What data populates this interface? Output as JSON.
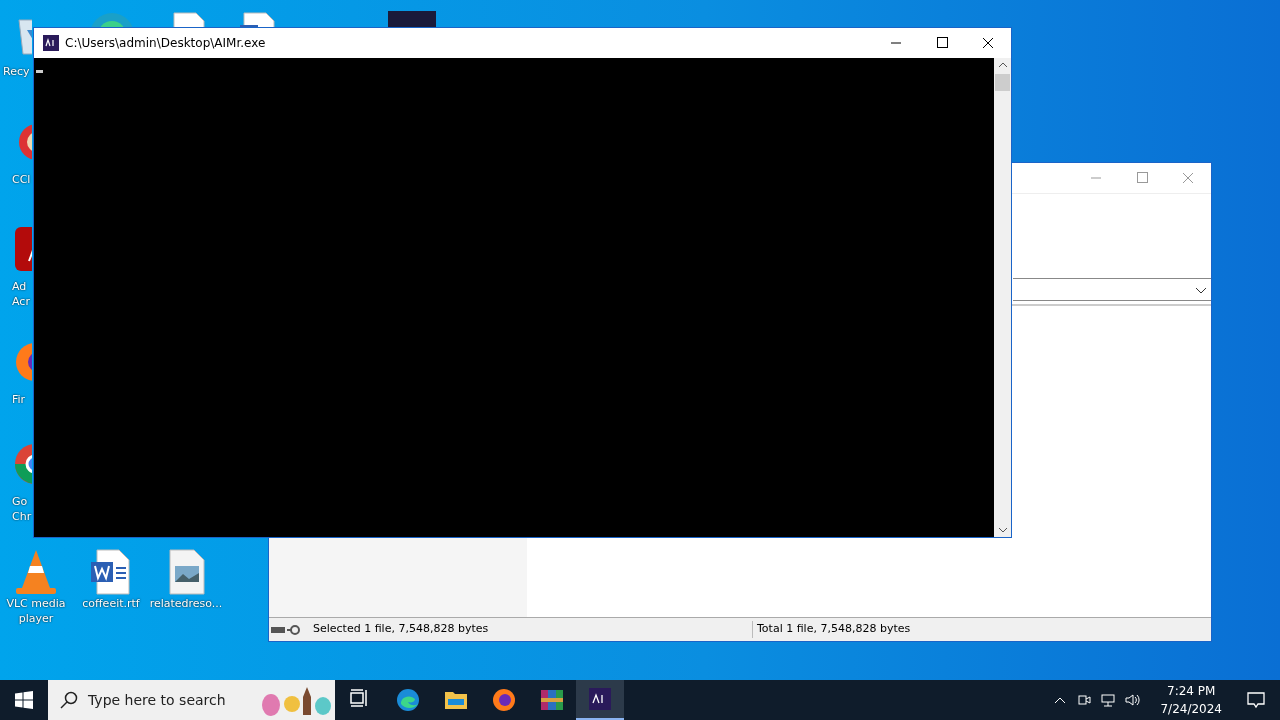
{
  "desktop_icons": [
    {
      "kind": "recycle",
      "lines": [
        "Recy"
      ]
    },
    {
      "kind": "ccleaner",
      "lines": [
        "CCl"
      ]
    },
    {
      "kind": "acrobat",
      "lines": [
        "Ad",
        "Acr"
      ]
    },
    {
      "kind": "firefox",
      "lines": [
        "Fir"
      ]
    },
    {
      "kind": "chrome",
      "lines": [
        "Go",
        "Chr"
      ]
    },
    {
      "kind": "vlc",
      "lines": [
        "VLC media",
        "player"
      ]
    },
    {
      "kind": "word",
      "lines": [
        "coffeeit.rtf"
      ]
    },
    {
      "kind": "image",
      "lines": [
        "relatedreso..."
      ]
    }
  ],
  "console": {
    "title": "C:\\Users\\admin\\Desktop\\AIMr.exe"
  },
  "back_window": {
    "status_left": "Selected 1 file, 7,548,828 bytes",
    "status_right": "Total 1 file, 7,548,828 bytes"
  },
  "taskbar": {
    "search_placeholder": "Type here to search",
    "apps": [
      {
        "kind": "taskview",
        "selected": false
      },
      {
        "kind": "edge",
        "selected": false
      },
      {
        "kind": "explorer",
        "selected": false
      },
      {
        "kind": "firefox",
        "selected": false
      },
      {
        "kind": "winrar",
        "selected": false
      },
      {
        "kind": "aimr",
        "selected": true
      }
    ],
    "time": "7:24 PM",
    "date": "7/24/2024"
  }
}
